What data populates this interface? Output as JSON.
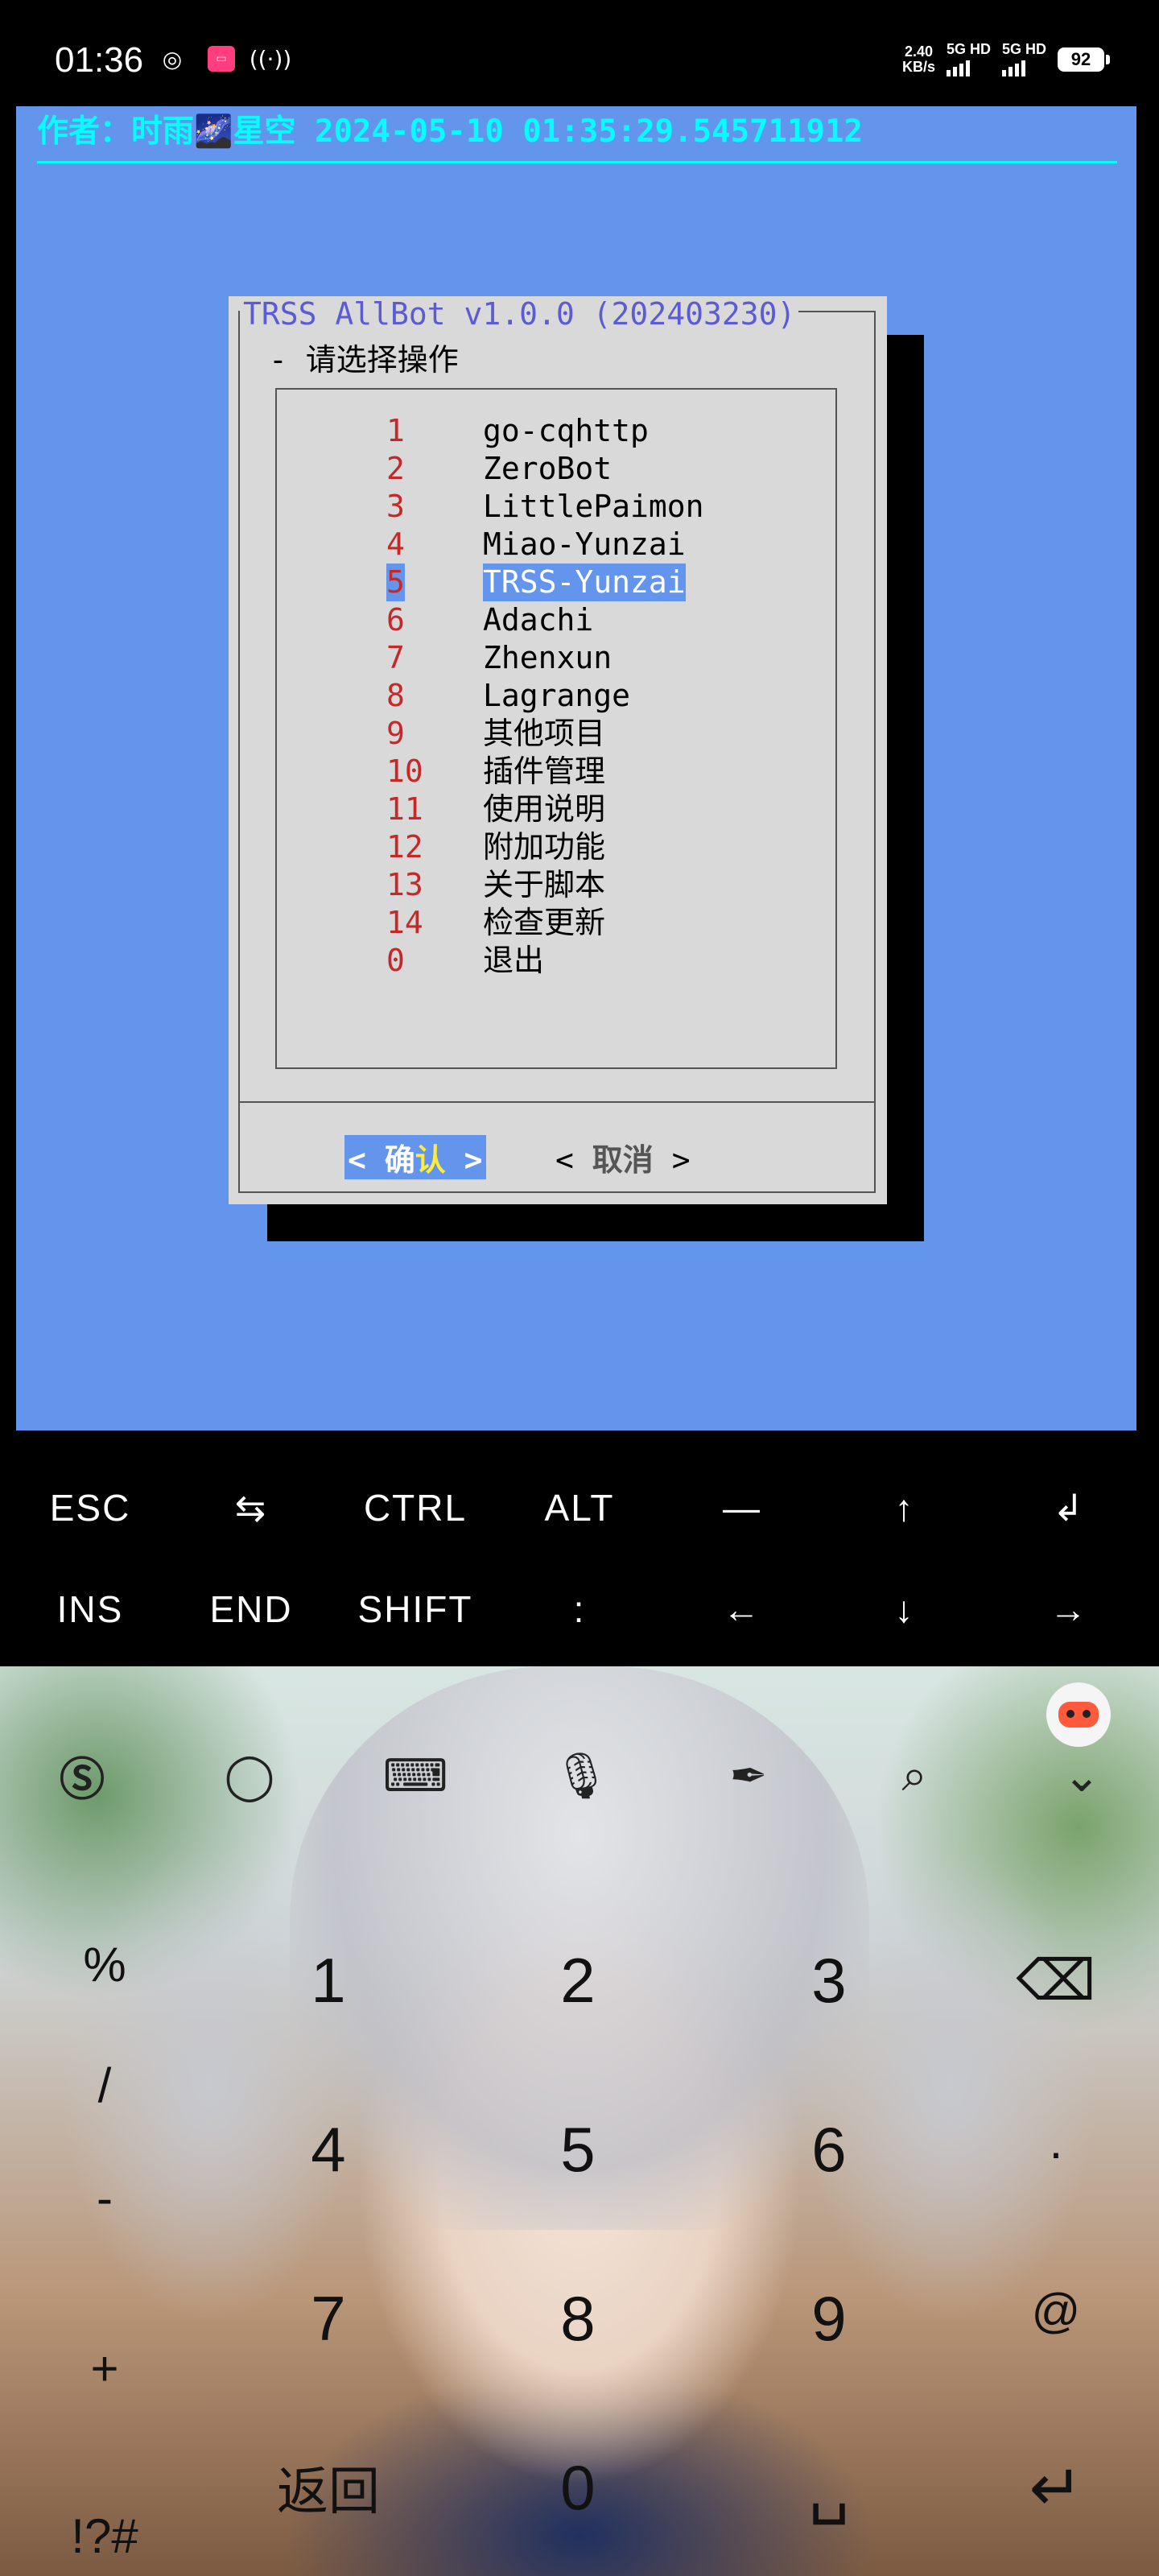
{
  "status_bar": {
    "time": "01:36",
    "speed_value": "2.40",
    "speed_unit": "KB/s",
    "sim1": "5G HD",
    "sim2": "5G HD",
    "battery": "92"
  },
  "terminal": {
    "author_line": "作者：时雨🌌星空 2024-05-10 01:35:29.545711912",
    "dialog": {
      "title": "TRSS AllBot v1.0.0 (202403230)",
      "prompt": "- 请选择操作",
      "items": [
        {
          "num": "1",
          "label": "go-cqhttp"
        },
        {
          "num": "2",
          "label": "ZeroBot"
        },
        {
          "num": "3",
          "label": "LittlePaimon"
        },
        {
          "num": "4",
          "label": "Miao-Yunzai"
        },
        {
          "num": "5",
          "label": "TRSS-Yunzai"
        },
        {
          "num": "6",
          "label": "Adachi"
        },
        {
          "num": "7",
          "label": "Zhenxun"
        },
        {
          "num": "8",
          "label": "Lagrange"
        },
        {
          "num": "9",
          "label": "其他项目"
        },
        {
          "num": "10",
          "label": "插件管理"
        },
        {
          "num": "11",
          "label": "使用说明"
        },
        {
          "num": "12",
          "label": "附加功能"
        },
        {
          "num": "13",
          "label": "关于脚本"
        },
        {
          "num": "14",
          "label": "检查更新"
        },
        {
          "num": "0",
          "label": "退出"
        }
      ],
      "selected_index": 4,
      "ok_left": "< ",
      "ok_text_1": "确",
      "ok_text_2": "认",
      "ok_right": " >",
      "cancel_left": "<",
      "cancel_text": "取消",
      "cancel_right": ">"
    }
  },
  "extra_keys": {
    "row1": [
      "ESC",
      "⇆",
      "CTRL",
      "ALT",
      "—",
      "↑",
      "↲"
    ],
    "row2": [
      "INS",
      "END",
      "SHIFT",
      ":",
      "←",
      "↓",
      "→"
    ]
  },
  "keyboard": {
    "numbers": [
      "1",
      "2",
      "3",
      "4",
      "5",
      "6",
      "7",
      "8",
      "9",
      "0"
    ],
    "left_col": [
      "%",
      "/",
      "-",
      "+"
    ],
    "right_col": [
      ".",
      "@"
    ],
    "symbols_key": "!?#",
    "back_key": "返回",
    "space_key": "␣",
    "enter_key": "↵",
    "backspace_key": "⌫"
  },
  "colors": {
    "terminal_bg": "#6495ed",
    "author_cyan": "#00ffff",
    "dialog_bg": "#d9d9d9",
    "title_blue": "#5b5bd6",
    "number_red": "#c62828",
    "ok_yellow": "#ffeb3b"
  }
}
